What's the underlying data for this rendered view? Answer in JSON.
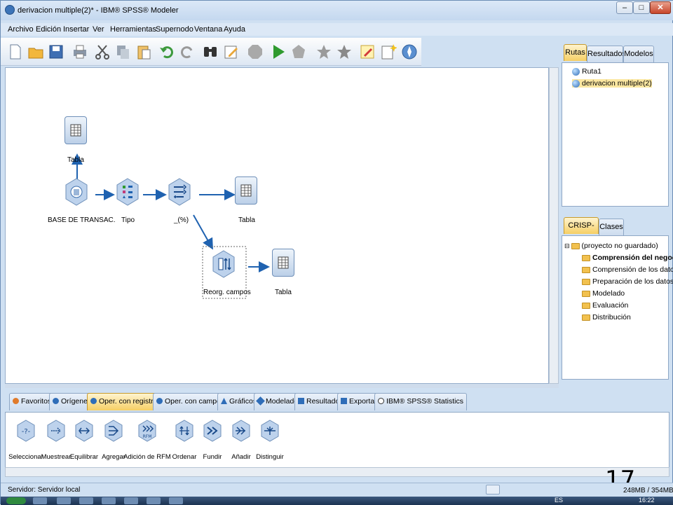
{
  "window": {
    "title": "derivacion multiple(2)* - IBM® SPSS® Modeler",
    "min": "–",
    "max": "□",
    "close": "✕"
  },
  "menu": [
    "Archivo",
    "Edición",
    "Insertar",
    "Ver",
    "Herramientas",
    "Supernodo",
    "Ventana",
    "Ayuda"
  ],
  "toolbar_icons": [
    "new-icon",
    "open-icon",
    "save-icon",
    "print-icon",
    "cut-icon",
    "copy-icon",
    "paste-icon",
    "undo-icon",
    "redo-icon",
    "find-icon",
    "edit-icon",
    "stop-icon",
    "run-icon",
    "supernode-icon",
    "star-icon",
    "star2-icon",
    "annotation-icon",
    "comment-icon",
    "compass-icon"
  ],
  "canvas": {
    "nodes": {
      "tabla_top": "Tabla",
      "base": "BASE DE TRANSAC.",
      "tipo": "Tipo",
      "derive": "_(%)",
      "tabla_right": "Tabla",
      "reorg": "Reorg. campos",
      "tabla_bottom": "Tabla"
    }
  },
  "right_top": {
    "tabs": [
      "Rutas",
      "Resultados",
      "Modelos"
    ],
    "items": [
      "Ruta1",
      "derivacion multiple(2)"
    ]
  },
  "right_bottom": {
    "tabs": [
      "CRISP-DM",
      "Clases"
    ],
    "root": "(proyecto no guardado)",
    "items": [
      "Comprensión del negocio",
      "Comprensión de los datos",
      "Preparación de los datos",
      "Modelado",
      "Evaluación",
      "Distribución"
    ]
  },
  "palette_tabs": [
    "Favoritos",
    "Orígenes",
    "Oper. con registros",
    "Oper. con campos",
    "Gráficos",
    "Modelado",
    "Resultado",
    "Exportar",
    "IBM® SPSS® Statistics"
  ],
  "palette_nodes": [
    "Seleccionar",
    "Muestrear",
    "Equilibrar",
    "Agregar",
    "Adición de RFM",
    "Ordenar",
    "Fundir",
    "Añadir",
    "Distinguir"
  ],
  "status": {
    "server": "Servidor: Servidor local",
    "memory": "248MB / 354MB"
  },
  "page_number": "17",
  "taskbar": {
    "lang": "ES",
    "time": "16:22"
  },
  "colors": {
    "accent": "#2b6cb0",
    "active_tab": "#f6cf64",
    "chrome": "#cfe0f2"
  }
}
